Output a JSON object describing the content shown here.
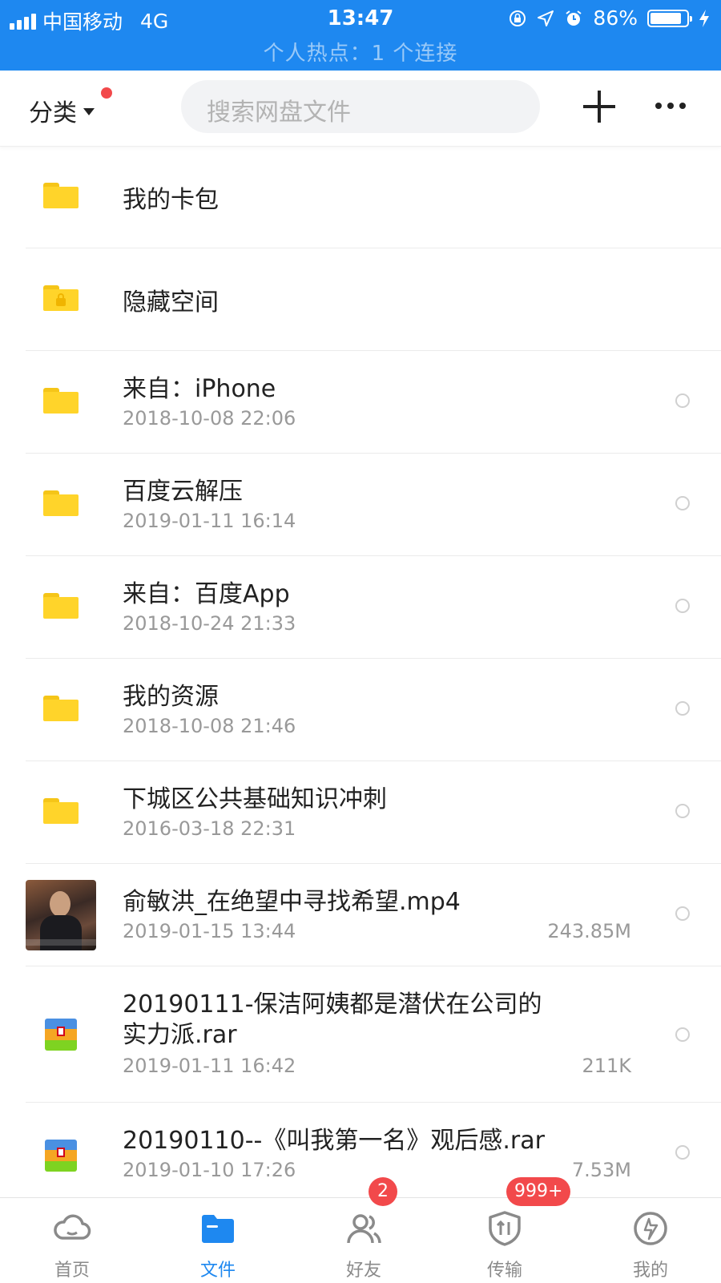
{
  "status_bar": {
    "carrier": "中国移动",
    "network": "4G",
    "time": "13:47",
    "battery_percent": "86%",
    "battery_level": 0.86,
    "hotspot_text": "个人热点：1 个连接"
  },
  "top_bar": {
    "category_label": "分类",
    "search_placeholder": "搜索网盘文件"
  },
  "files": [
    {
      "name": "我的卡包",
      "date": "",
      "size": "",
      "type": "folder"
    },
    {
      "name": "隐藏空间",
      "date": "",
      "size": "",
      "type": "locked-folder"
    },
    {
      "name": "来自：iPhone",
      "date": "2018-10-08 22:06",
      "size": "",
      "type": "folder"
    },
    {
      "name": "百度云解压",
      "date": "2019-01-11 16:14",
      "size": "",
      "type": "folder"
    },
    {
      "name": "来自：百度App",
      "date": "2018-10-24 21:33",
      "size": "",
      "type": "folder"
    },
    {
      "name": "我的资源",
      "date": "2018-10-08 21:46",
      "size": "",
      "type": "folder"
    },
    {
      "name": "下城区公共基础知识冲刺",
      "date": "2016-03-18 22:31",
      "size": "",
      "type": "folder"
    },
    {
      "name": "俞敏洪_在绝望中寻找希望.mp4",
      "date": "2019-01-15 13:44",
      "size": "243.85M",
      "type": "video"
    },
    {
      "name_line1": "20190111-保洁阿姨都是潜伏在公司的",
      "name_line2": "实力派.rar",
      "date": "2019-01-11 16:42",
      "size": "211K",
      "type": "rar"
    },
    {
      "name": "20190110--《叫我第一名》观后感.rar",
      "date": "2019-01-10 17:26",
      "size": "7.53M",
      "type": "rar"
    }
  ],
  "bottom_nav": [
    {
      "label": "首页",
      "icon": "cloud-icon",
      "active": false
    },
    {
      "label": "文件",
      "icon": "folder-icon",
      "active": true
    },
    {
      "label": "好友",
      "icon": "friends-icon",
      "badge": "2",
      "active": false
    },
    {
      "label": "传输",
      "icon": "transfer-icon",
      "badge": "999+",
      "active": false
    },
    {
      "label": "我的",
      "icon": "profile-icon",
      "active": false
    }
  ],
  "colors": {
    "brand_blue": "#1E88F0",
    "folder_yellow": "#FFD42A",
    "badge_red": "#F2494B"
  }
}
